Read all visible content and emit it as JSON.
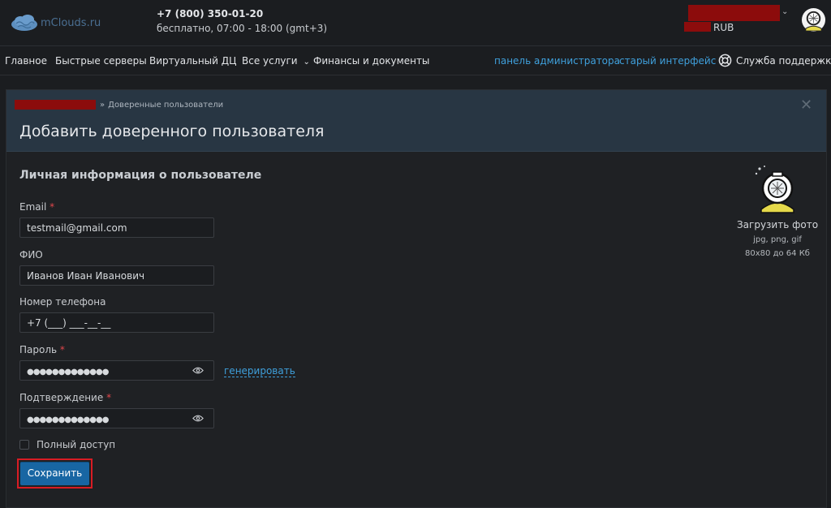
{
  "header": {
    "brand": "mClouds.ru",
    "phone": "+7 (800) 350-01-20",
    "hours": "бесплатно, 07:00 - 18:00 (gmt+3)",
    "currency": "RUB",
    "account_chevron": "⌄"
  },
  "nav": {
    "items": [
      "Главное",
      "Быстрые серверы",
      "Виртуальный ДЦ",
      "Все услуги",
      "Финансы и документы"
    ],
    "services_chevron": "⌄",
    "admin_panel": "панель администратора",
    "old_interface": "старый интерфейс",
    "support": "Служба поддержки"
  },
  "page": {
    "breadcrumb_sep": "»",
    "breadcrumb_current": "Доверенные пользователи",
    "title": "Добавить доверенного пользователя",
    "close": "✕"
  },
  "form": {
    "section_title": "Личная информация о пользователе",
    "email_label": "Email",
    "email_value": "testmail@gmail.com",
    "fio_label": "ФИО",
    "fio_value": "Иванов Иван Иванович",
    "phone_label": "Номер телефона",
    "phone_value": "+7 (___) ___-__-__",
    "password_label": "Пароль",
    "password_value": "●●●●●●●●●●●●●",
    "generate": "генерировать",
    "confirm_label": "Подтверждение",
    "confirm_value": "●●●●●●●●●●●●●",
    "required_mark": "*",
    "full_access": "Полный доступ",
    "save": "Сохранить"
  },
  "photo": {
    "upload": "Загрузить фото",
    "formats": "jpg, png, gif",
    "limits": "80x80 до 64 Кб"
  },
  "icons": [
    "cloud-logo-icon",
    "chevron-down-icon",
    "avatar-icon",
    "lifebuoy-icon",
    "close-icon",
    "eye-icon"
  ],
  "colors": {
    "accent": "#3fa0dc",
    "button": "#1866a3",
    "highlight": "#d81c24",
    "redaction": "#8c0c0c",
    "panel_header": "#283643"
  }
}
